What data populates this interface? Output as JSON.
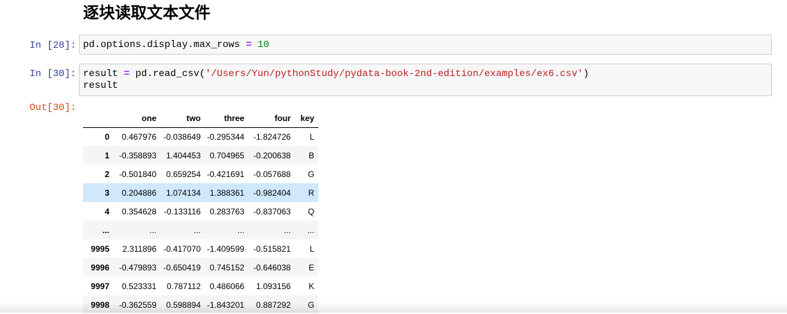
{
  "heading": "逐块读取文本文件",
  "cells": [
    {
      "prompt": "In [28]:",
      "code_tokens": [
        "pd.options.display.max_rows ",
        "=",
        " ",
        "10"
      ]
    },
    {
      "prompt": "In [30]:",
      "line1_tokens": [
        "result ",
        "=",
        " pd.read_csv(",
        "'/Users/Yun/pythonStudy/pydata-book-2nd-edition/examples/ex6.csv'",
        ")"
      ],
      "line2": "result"
    }
  ],
  "output": {
    "prompt": "Out[30]:",
    "columns": [
      "",
      "one",
      "two",
      "three",
      "four",
      "key"
    ],
    "rows": [
      [
        "0",
        "0.467976",
        "-0.038649",
        "-0.295344",
        "-1.824726",
        "L"
      ],
      [
        "1",
        "-0.358893",
        "1.404453",
        "0.704965",
        "-0.200638",
        "B"
      ],
      [
        "2",
        "-0.501840",
        "0.659254",
        "-0.421691",
        "-0.057688",
        "G"
      ],
      [
        "3",
        "0.204886",
        "1.074134",
        "1.388361",
        "-0.982404",
        "R"
      ],
      [
        "4",
        "0.354628",
        "-0.133116",
        "0.283763",
        "-0.837063",
        "Q"
      ],
      [
        "...",
        "...",
        "...",
        "...",
        "...",
        "..."
      ],
      [
        "9995",
        "2.311896",
        "-0.417070",
        "-1.409599",
        "-0.515821",
        "L"
      ],
      [
        "9996",
        "-0.479893",
        "-0.650419",
        "0.745152",
        "-0.646038",
        "E"
      ],
      [
        "9997",
        "0.523331",
        "0.787112",
        "0.486066",
        "1.093156",
        "K"
      ],
      [
        "9998",
        "-0.362559",
        "0.598894",
        "-1.843201",
        "0.887292",
        "G"
      ]
    ],
    "highlighted_row": 3
  }
}
